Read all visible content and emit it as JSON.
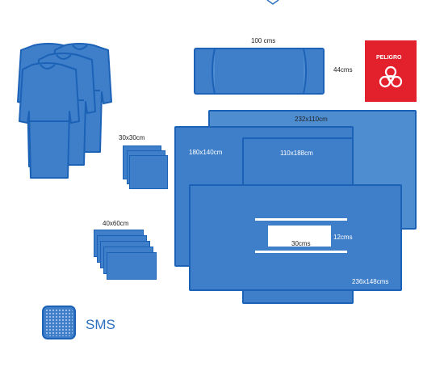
{
  "labels": {
    "towel_100": "100 cms",
    "towel_44": "44cms",
    "hazard": "PELIGRO",
    "small_30": "30x30cm",
    "small_40": "40x60cm",
    "sheet_232": "232x110cm",
    "sheet_180": "180x140cm",
    "sheet_110": "110x188cm",
    "sheet_236": "236x148cms",
    "window_w": "30cms",
    "window_h": "12cms",
    "material": "SMS"
  },
  "icons": {
    "gowns": "surgical-gown-icon",
    "hazard": "biohazard-icon",
    "material": "sms-fabric-swatch-icon"
  },
  "colors": {
    "fabric": "#3f7fc9",
    "fabric_border": "#1b62b7",
    "hazard_bg": "#e3212d",
    "material_text": "#2a6fc1"
  }
}
